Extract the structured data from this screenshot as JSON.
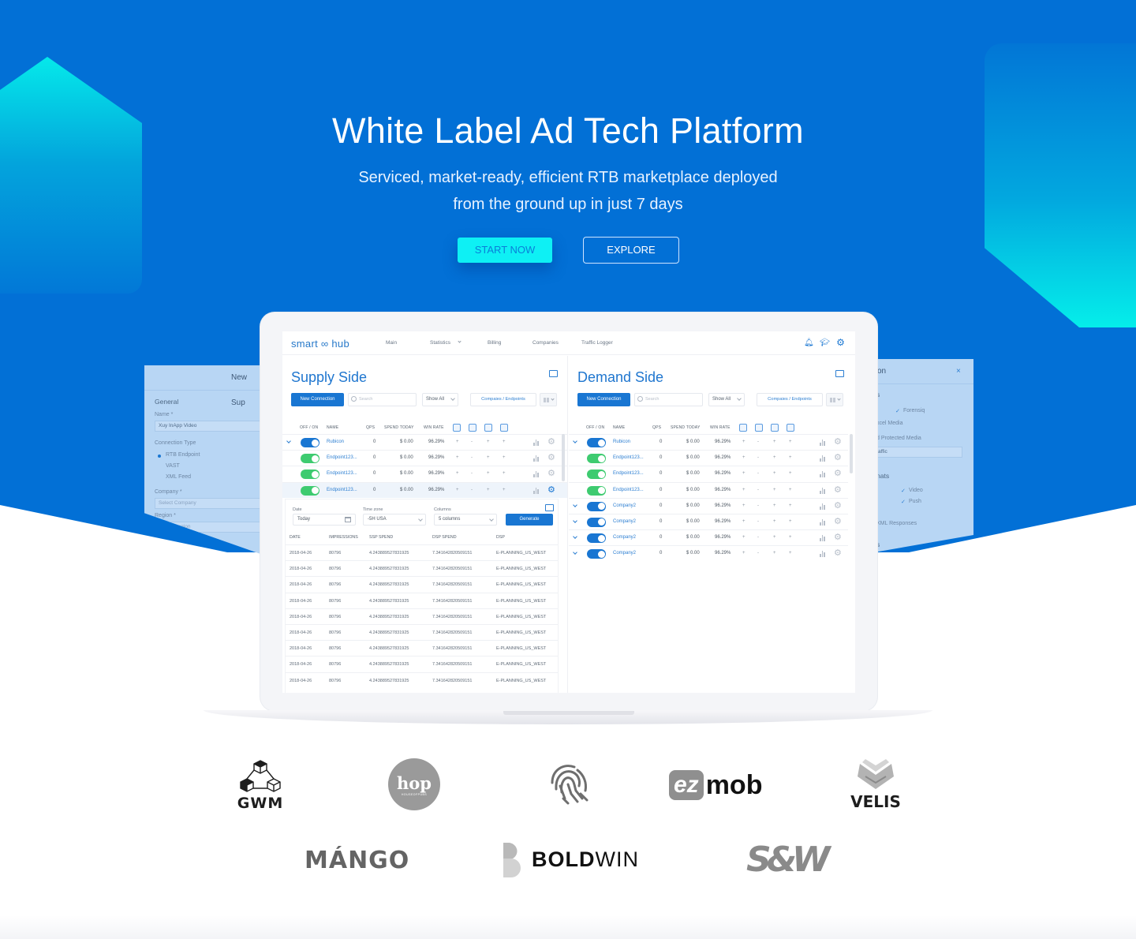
{
  "hero": {
    "title": "White Label Ad Tech Platform",
    "subtitle_line1": "Serviced, market-ready, efficient RTB marketplace deployed",
    "subtitle_line2": "from the ground up in just 7 days",
    "start_label": "START NOW",
    "explore_label": "EXPLORE",
    "colors": {
      "background": "#0270d6",
      "accent": "#0ef0f4"
    }
  },
  "left_panel": {
    "title": "New Sup",
    "section": "General",
    "name_label": "Name *",
    "name_value": "Xuy InApp Video",
    "conn_type_label": "Connection Type",
    "conn_options": [
      "RTB Endpoint",
      "VAST",
      "XML Feed"
    ],
    "company_label": "Company *",
    "company_placeholder": "Select Company",
    "region_label": "Region *",
    "region_placeholder": "Select Region"
  },
  "right_panel": {
    "title": "on",
    "close": "×",
    "s1": "s",
    "forensiq": "Forensiq",
    "excel_media": "xcel Media",
    "protected_media": "d Protected Media",
    "traffic_value": "affic",
    "formats": "nats",
    "video": "Video",
    "push": "Push",
    "xml_responses": "XML Responses",
    "s2": "s"
  },
  "app": {
    "logo": "smart ∞ hub",
    "nav": [
      "Main",
      "Statistics",
      "Billing",
      "Companies",
      "Traffic Logger"
    ],
    "icons": [
      "bell-icon",
      "graduation-cap-icon",
      "gear-icon"
    ]
  },
  "supply": {
    "title": "Supply Side",
    "new_connection": "New Connection",
    "search_placeholder": "Search",
    "show_all": "Show All",
    "companies_endpoints": "Compaies / Endpoints",
    "headers": [
      "OFF / ON",
      "NAME",
      "QPS",
      "SPEND TODAY",
      "WIN RATE"
    ],
    "rows": [
      {
        "name": "Rubicon",
        "qps": "0",
        "spend": "$ 0.00",
        "win": "96.29%",
        "type": "company",
        "toggle": "blue"
      },
      {
        "name": "Endpoint123...",
        "qps": "0",
        "spend": "$ 0.00",
        "win": "96.29%",
        "type": "endpoint",
        "toggle": "green"
      },
      {
        "name": "Endpoint123...",
        "qps": "0",
        "spend": "$ 0.00",
        "win": "96.29%",
        "type": "endpoint",
        "toggle": "green"
      },
      {
        "name": "Endpoint123...",
        "qps": "0",
        "spend": "$ 0.00",
        "win": "96.29%",
        "type": "endpoint",
        "toggle": "green",
        "highlight": true
      }
    ],
    "report": {
      "date_label": "Date",
      "date_value": "Today",
      "tz_label": "Time zone",
      "tz_value": "-5H USA",
      "columns_label": "Columns",
      "columns_value": "5 columns",
      "generate": "Generate",
      "headers": [
        "DATE",
        "IMPRESSIONS",
        "SSP SPEND",
        "DSP SPEND",
        "DSP"
      ],
      "rows": [
        [
          "2018-04-26",
          "80796",
          "4.243889527831925",
          "7.341642820509151",
          "E-PLANNING_US_WEST"
        ],
        [
          "2018-04-26",
          "80796",
          "4.243889527831925",
          "7.341642820509151",
          "E-PLANNING_US_WEST"
        ],
        [
          "2018-04-26",
          "80796",
          "4.243889527831925",
          "7.341642820509151",
          "E-PLANNING_US_WEST"
        ],
        [
          "2018-04-26",
          "80796",
          "4.243889527831925",
          "7.341642820509151",
          "E-PLANNING_US_WEST"
        ],
        [
          "2018-04-26",
          "80796",
          "4.243889527831925",
          "7.341642820509151",
          "E-PLANNING_US_WEST"
        ],
        [
          "2018-04-26",
          "80796",
          "4.243889527831925",
          "7.341642820509151",
          "E-PLANNING_US_WEST"
        ],
        [
          "2018-04-26",
          "80796",
          "4.243889527831925",
          "7.341642820509151",
          "E-PLANNING_US_WEST"
        ],
        [
          "2018-04-26",
          "80796",
          "4.243889527831925",
          "7.341642820509151",
          "E-PLANNING_US_WEST"
        ],
        [
          "2018-04-26",
          "80796",
          "4.243889527831925",
          "7.341642820509151",
          "E-PLANNING_US_WEST"
        ]
      ]
    }
  },
  "demand": {
    "title": "Demand Side",
    "new_connection": "New Connection",
    "search_placeholder": "Search",
    "show_all": "Show All",
    "companies_endpoints": "Compaies / Endpoints",
    "headers": [
      "OFF / ON",
      "NAME",
      "QPS",
      "SPEND TODAY",
      "WIN RATE"
    ],
    "rows": [
      {
        "name": "Rubicon",
        "qps": "0",
        "spend": "$ 0.00",
        "win": "96.29%",
        "type": "company",
        "toggle": "blue"
      },
      {
        "name": "Endpoint123...",
        "qps": "0",
        "spend": "$ 0.00",
        "win": "96.29%",
        "type": "endpoint",
        "toggle": "green"
      },
      {
        "name": "Endpoint123...",
        "qps": "0",
        "spend": "$ 0.00",
        "win": "96.29%",
        "type": "endpoint",
        "toggle": "green"
      },
      {
        "name": "Endpoint123...",
        "qps": "0",
        "spend": "$ 0.00",
        "win": "96.29%",
        "type": "endpoint",
        "toggle": "green"
      },
      {
        "name": "Company2",
        "qps": "0",
        "spend": "$ 0.00",
        "win": "96.29%",
        "type": "company",
        "toggle": "blue"
      },
      {
        "name": "Company2",
        "qps": "0",
        "spend": "$ 0.00",
        "win": "96.29%",
        "type": "company",
        "toggle": "blue"
      },
      {
        "name": "Company2",
        "qps": "0",
        "spend": "$ 0.00",
        "win": "96.29%",
        "type": "company",
        "toggle": "blue"
      },
      {
        "name": "Company2",
        "qps": "0",
        "spend": "$ 0.00",
        "win": "96.29%",
        "type": "company",
        "toggle": "blue"
      }
    ]
  },
  "row_actions": [
    "+",
    "-",
    "+",
    "+"
  ],
  "brands": [
    "GWM",
    "hop",
    "fingerprint",
    "ezmob",
    "VELIS",
    "MANGO",
    "BOLDWIN",
    "S&W"
  ],
  "brand_text": {
    "gwm": "GWM",
    "hop": "hop",
    "hop_sub": "HOUSEOFPUBS",
    "ez": "ez",
    "mob": "mob",
    "velis": "VELIS",
    "mango": "MÁNGO",
    "bold": "BOLD",
    "win": "WIN",
    "sw": "S&W"
  }
}
